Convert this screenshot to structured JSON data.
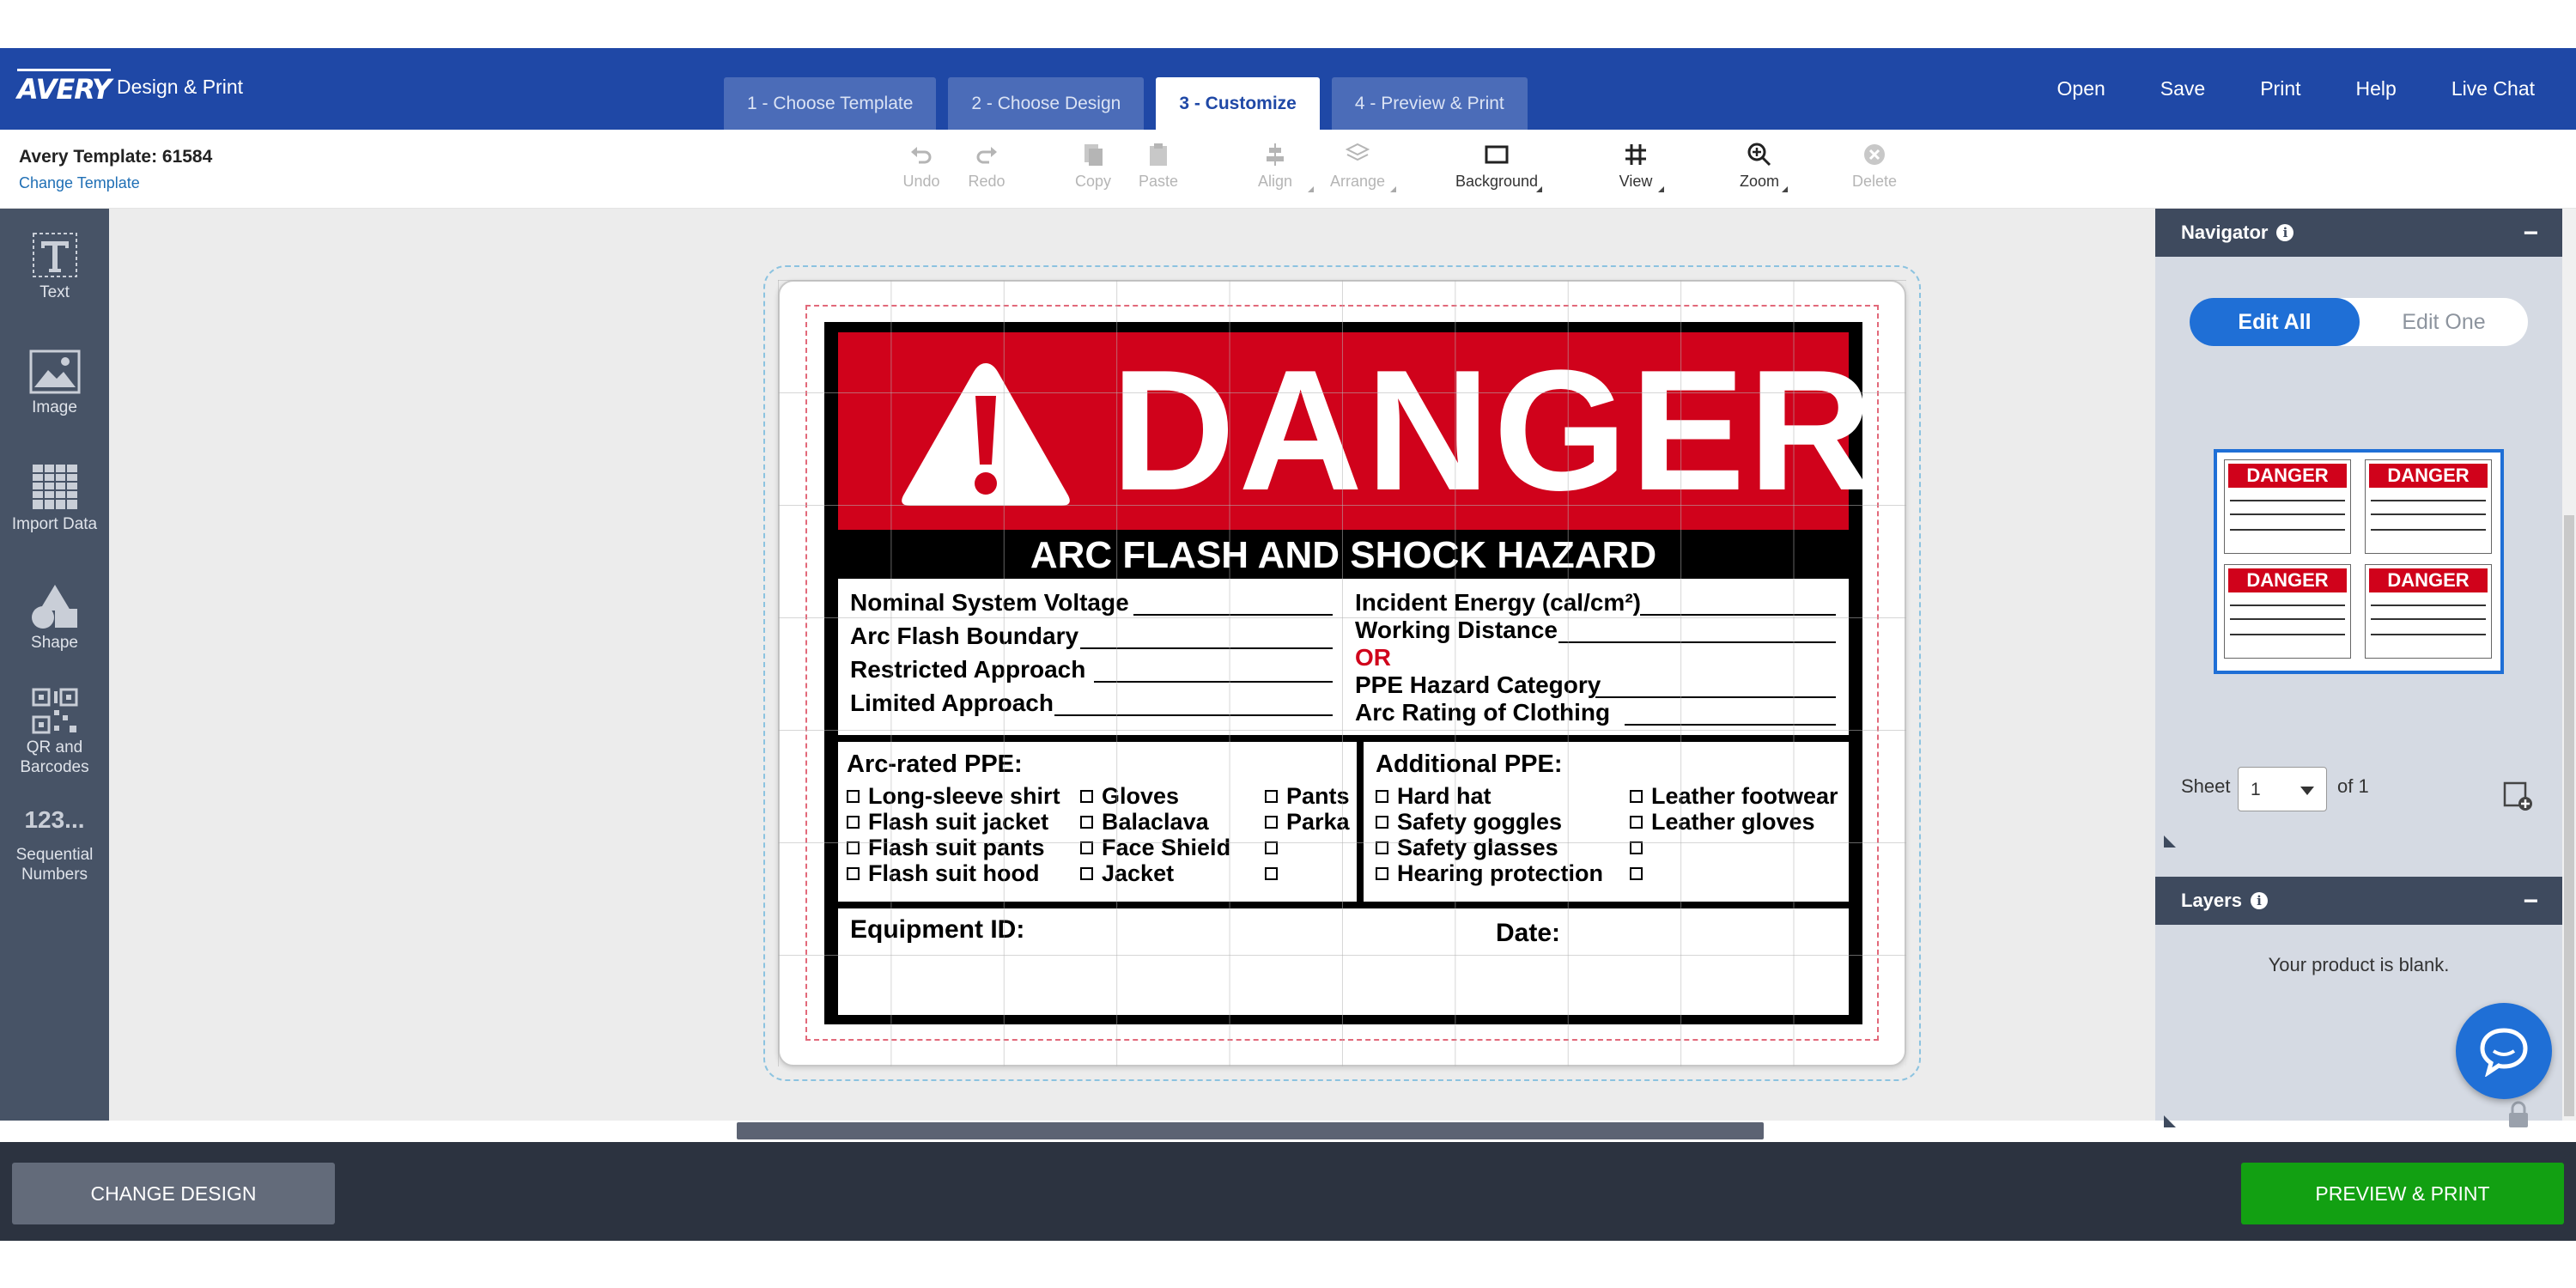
{
  "header": {
    "logo": "AVERY",
    "app_name": "Design & Print",
    "steps": [
      "1 - Choose Template",
      "2 - Choose Design",
      "3 - Customize",
      "4 - Preview & Print"
    ],
    "active_step": "3 - Customize",
    "nav": [
      "Open",
      "Save",
      "Print",
      "Help",
      "Live Chat"
    ]
  },
  "toolbar": {
    "template_name": "Avery Template: 61584",
    "change_template": "Change Template",
    "tools": {
      "undo": "Undo",
      "redo": "Redo",
      "copy": "Copy",
      "paste": "Paste",
      "align": "Align",
      "arrange": "Arrange",
      "background": "Background",
      "view": "View",
      "zoom": "Zoom",
      "delete": "Delete"
    }
  },
  "sidebar": {
    "items": [
      "Text",
      "Image",
      "Import Data",
      "Shape",
      "QR and Barcodes",
      "Sequential Numbers"
    ],
    "seq_icon_text": "123..."
  },
  "label": {
    "danger": "DANGER",
    "subtitle": "ARC FLASH AND SHOCK HAZARD",
    "left_fields": [
      "Nominal System Voltage",
      "Arc Flash Boundary",
      "Restricted Approach",
      "Limited Approach"
    ],
    "right_fields": [
      "Incident Energy (cal/cm²)",
      "Working Distance",
      "OR",
      "PPE Hazard Category",
      "Arc Rating of Clothing"
    ],
    "arc_ppe_title": "Arc-rated PPE:",
    "arc_ppe": {
      "col1": [
        "Long-sleeve shirt",
        "Flash suit jacket",
        "Flash suit pants",
        "Flash suit hood"
      ],
      "col2": [
        "Gloves",
        "Balaclava",
        "Face Shield",
        "Jacket"
      ],
      "col3": [
        "Pants",
        "Parka",
        "",
        ""
      ]
    },
    "add_ppe_title": "Additional PPE:",
    "add_ppe": {
      "col1": [
        "Hard hat",
        "Safety goggles",
        "Safety glasses",
        "Hearing protection"
      ],
      "col2": [
        "Leather footwear",
        "Leather gloves",
        "",
        ""
      ]
    },
    "equipment_id": "Equipment ID:",
    "date": "Date:"
  },
  "navigator": {
    "title": "Navigator",
    "edit_all": "Edit All",
    "edit_one": "Edit One",
    "thumb_label": "DANGER",
    "sheet_label": "Sheet",
    "sheet_value": "1",
    "of_label": "of 1"
  },
  "layers": {
    "title": "Layers",
    "empty_message": "Your product is blank."
  },
  "bottom": {
    "change_design": "CHANGE DESIGN",
    "preview_print": "PREVIEW & PRINT"
  },
  "colors": {
    "header_blue": "#1f48a6",
    "danger_red": "#d0021b",
    "accent_blue": "#1f6fd6",
    "preview_green": "#12a012"
  }
}
